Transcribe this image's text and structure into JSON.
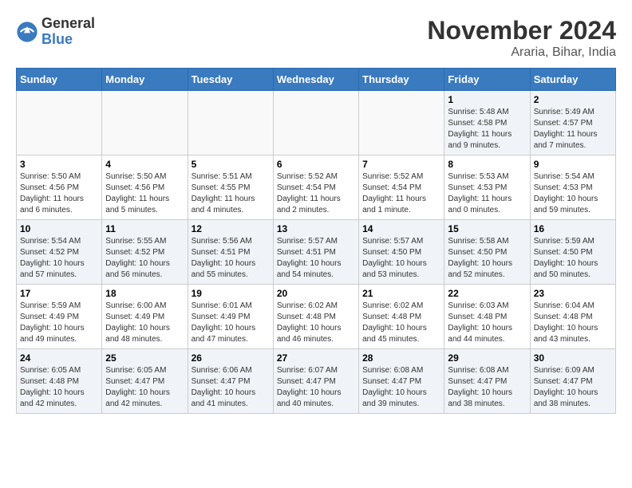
{
  "logo": {
    "general": "General",
    "blue": "Blue"
  },
  "title": {
    "month": "November 2024",
    "location": "Araria, Bihar, India"
  },
  "headers": [
    "Sunday",
    "Monday",
    "Tuesday",
    "Wednesday",
    "Thursday",
    "Friday",
    "Saturday"
  ],
  "weeks": [
    [
      {
        "day": "",
        "info": ""
      },
      {
        "day": "",
        "info": ""
      },
      {
        "day": "",
        "info": ""
      },
      {
        "day": "",
        "info": ""
      },
      {
        "day": "",
        "info": ""
      },
      {
        "day": "1",
        "info": "Sunrise: 5:48 AM\nSunset: 4:58 PM\nDaylight: 11 hours and 9 minutes."
      },
      {
        "day": "2",
        "info": "Sunrise: 5:49 AM\nSunset: 4:57 PM\nDaylight: 11 hours and 7 minutes."
      }
    ],
    [
      {
        "day": "3",
        "info": "Sunrise: 5:50 AM\nSunset: 4:56 PM\nDaylight: 11 hours and 6 minutes."
      },
      {
        "day": "4",
        "info": "Sunrise: 5:50 AM\nSunset: 4:56 PM\nDaylight: 11 hours and 5 minutes."
      },
      {
        "day": "5",
        "info": "Sunrise: 5:51 AM\nSunset: 4:55 PM\nDaylight: 11 hours and 4 minutes."
      },
      {
        "day": "6",
        "info": "Sunrise: 5:52 AM\nSunset: 4:54 PM\nDaylight: 11 hours and 2 minutes."
      },
      {
        "day": "7",
        "info": "Sunrise: 5:52 AM\nSunset: 4:54 PM\nDaylight: 11 hours and 1 minute."
      },
      {
        "day": "8",
        "info": "Sunrise: 5:53 AM\nSunset: 4:53 PM\nDaylight: 11 hours and 0 minutes."
      },
      {
        "day": "9",
        "info": "Sunrise: 5:54 AM\nSunset: 4:53 PM\nDaylight: 10 hours and 59 minutes."
      }
    ],
    [
      {
        "day": "10",
        "info": "Sunrise: 5:54 AM\nSunset: 4:52 PM\nDaylight: 10 hours and 57 minutes."
      },
      {
        "day": "11",
        "info": "Sunrise: 5:55 AM\nSunset: 4:52 PM\nDaylight: 10 hours and 56 minutes."
      },
      {
        "day": "12",
        "info": "Sunrise: 5:56 AM\nSunset: 4:51 PM\nDaylight: 10 hours and 55 minutes."
      },
      {
        "day": "13",
        "info": "Sunrise: 5:57 AM\nSunset: 4:51 PM\nDaylight: 10 hours and 54 minutes."
      },
      {
        "day": "14",
        "info": "Sunrise: 5:57 AM\nSunset: 4:50 PM\nDaylight: 10 hours and 53 minutes."
      },
      {
        "day": "15",
        "info": "Sunrise: 5:58 AM\nSunset: 4:50 PM\nDaylight: 10 hours and 52 minutes."
      },
      {
        "day": "16",
        "info": "Sunrise: 5:59 AM\nSunset: 4:50 PM\nDaylight: 10 hours and 50 minutes."
      }
    ],
    [
      {
        "day": "17",
        "info": "Sunrise: 5:59 AM\nSunset: 4:49 PM\nDaylight: 10 hours and 49 minutes."
      },
      {
        "day": "18",
        "info": "Sunrise: 6:00 AM\nSunset: 4:49 PM\nDaylight: 10 hours and 48 minutes."
      },
      {
        "day": "19",
        "info": "Sunrise: 6:01 AM\nSunset: 4:49 PM\nDaylight: 10 hours and 47 minutes."
      },
      {
        "day": "20",
        "info": "Sunrise: 6:02 AM\nSunset: 4:48 PM\nDaylight: 10 hours and 46 minutes."
      },
      {
        "day": "21",
        "info": "Sunrise: 6:02 AM\nSunset: 4:48 PM\nDaylight: 10 hours and 45 minutes."
      },
      {
        "day": "22",
        "info": "Sunrise: 6:03 AM\nSunset: 4:48 PM\nDaylight: 10 hours and 44 minutes."
      },
      {
        "day": "23",
        "info": "Sunrise: 6:04 AM\nSunset: 4:48 PM\nDaylight: 10 hours and 43 minutes."
      }
    ],
    [
      {
        "day": "24",
        "info": "Sunrise: 6:05 AM\nSunset: 4:48 PM\nDaylight: 10 hours and 42 minutes."
      },
      {
        "day": "25",
        "info": "Sunrise: 6:05 AM\nSunset: 4:47 PM\nDaylight: 10 hours and 42 minutes."
      },
      {
        "day": "26",
        "info": "Sunrise: 6:06 AM\nSunset: 4:47 PM\nDaylight: 10 hours and 41 minutes."
      },
      {
        "day": "27",
        "info": "Sunrise: 6:07 AM\nSunset: 4:47 PM\nDaylight: 10 hours and 40 minutes."
      },
      {
        "day": "28",
        "info": "Sunrise: 6:08 AM\nSunset: 4:47 PM\nDaylight: 10 hours and 39 minutes."
      },
      {
        "day": "29",
        "info": "Sunrise: 6:08 AM\nSunset: 4:47 PM\nDaylight: 10 hours and 38 minutes."
      },
      {
        "day": "30",
        "info": "Sunrise: 6:09 AM\nSunset: 4:47 PM\nDaylight: 10 hours and 38 minutes."
      }
    ]
  ]
}
